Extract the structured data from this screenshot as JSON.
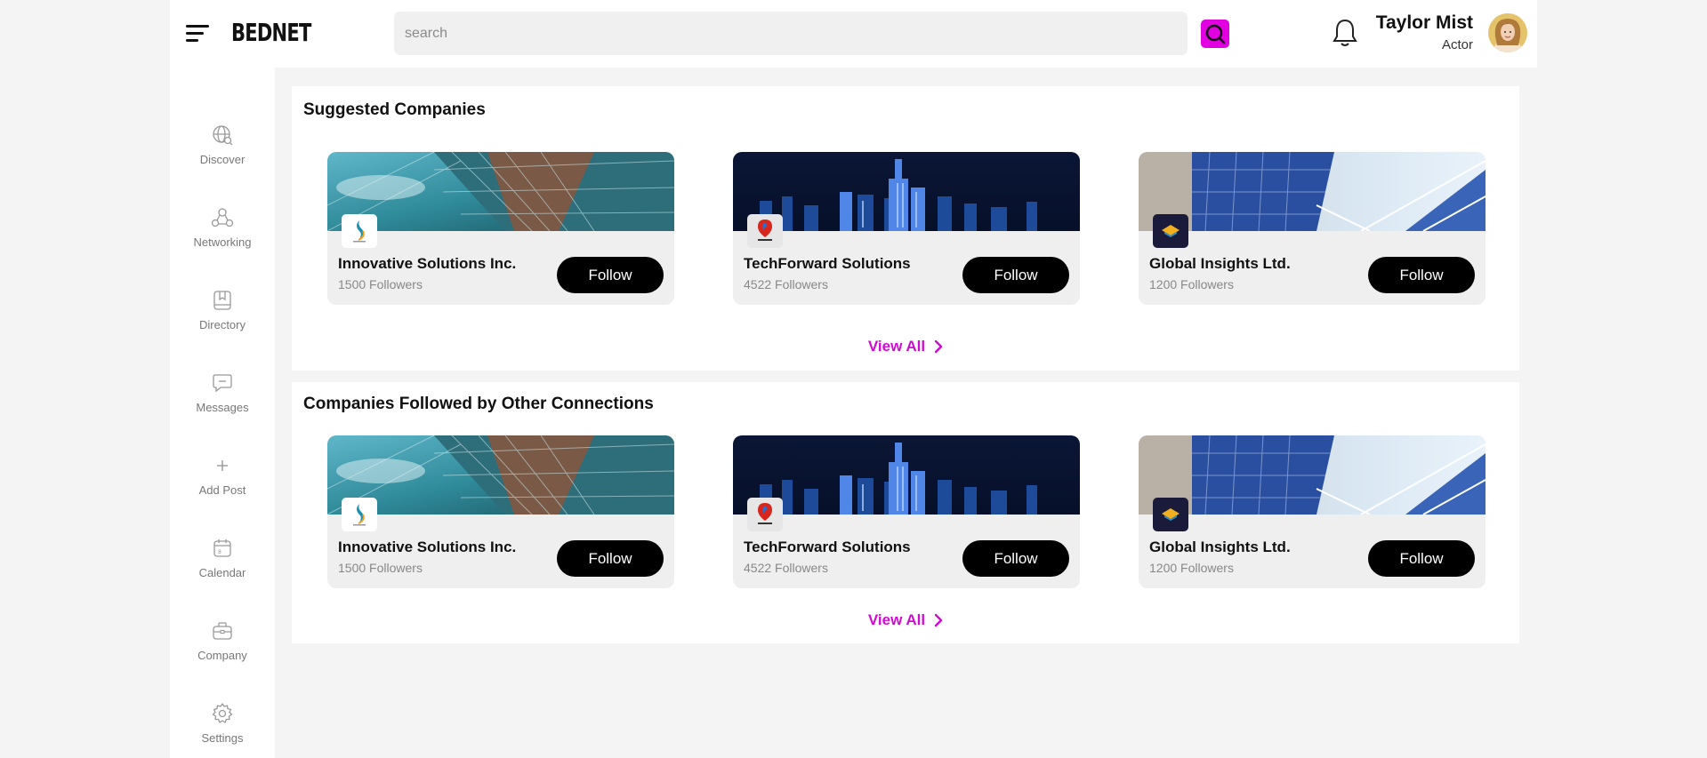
{
  "app": {
    "logo": "BEDNET"
  },
  "header": {
    "search_placeholder": "search",
    "user_name": "Taylor Mist",
    "user_role": "Actor",
    "accent_color": "#e000e0"
  },
  "sidebar": {
    "items": [
      {
        "label": "Discover",
        "icon": "globe-search-icon"
      },
      {
        "label": "Networking",
        "icon": "network-icon"
      },
      {
        "label": "Directory",
        "icon": "bookmark-icon"
      },
      {
        "label": "Messages",
        "icon": "message-icon"
      },
      {
        "label": "Add Post",
        "icon": "plus-icon"
      },
      {
        "label": "Calendar",
        "icon": "calendar-icon"
      },
      {
        "label": "Company",
        "icon": "briefcase-icon"
      },
      {
        "label": "Settings",
        "icon": "gear-icon"
      }
    ]
  },
  "sections": [
    {
      "title": "Suggested Companies",
      "view_all": "View All",
      "cards": [
        {
          "name": "Innovative Solutions Inc.",
          "followers": "1500 Followers",
          "button": "Follow",
          "banner": "glass-building"
        },
        {
          "name": "TechForward Solutions",
          "followers": "4522 Followers",
          "button": "Follow",
          "banner": "night-skyline"
        },
        {
          "name": "Global Insights Ltd.",
          "followers": "1200 Followers",
          "button": "Follow",
          "banner": "blue-towers"
        }
      ]
    },
    {
      "title": "Companies Followed by Other Connections",
      "view_all": "View All",
      "cards": [
        {
          "name": "Innovative Solutions Inc.",
          "followers": "1500 Followers",
          "button": "Follow",
          "banner": "glass-building"
        },
        {
          "name": "TechForward Solutions",
          "followers": "4522 Followers",
          "button": "Follow",
          "banner": "night-skyline"
        },
        {
          "name": "Global Insights Ltd.",
          "followers": "1200 Followers",
          "button": "Follow",
          "banner": "blue-towers"
        }
      ]
    }
  ]
}
